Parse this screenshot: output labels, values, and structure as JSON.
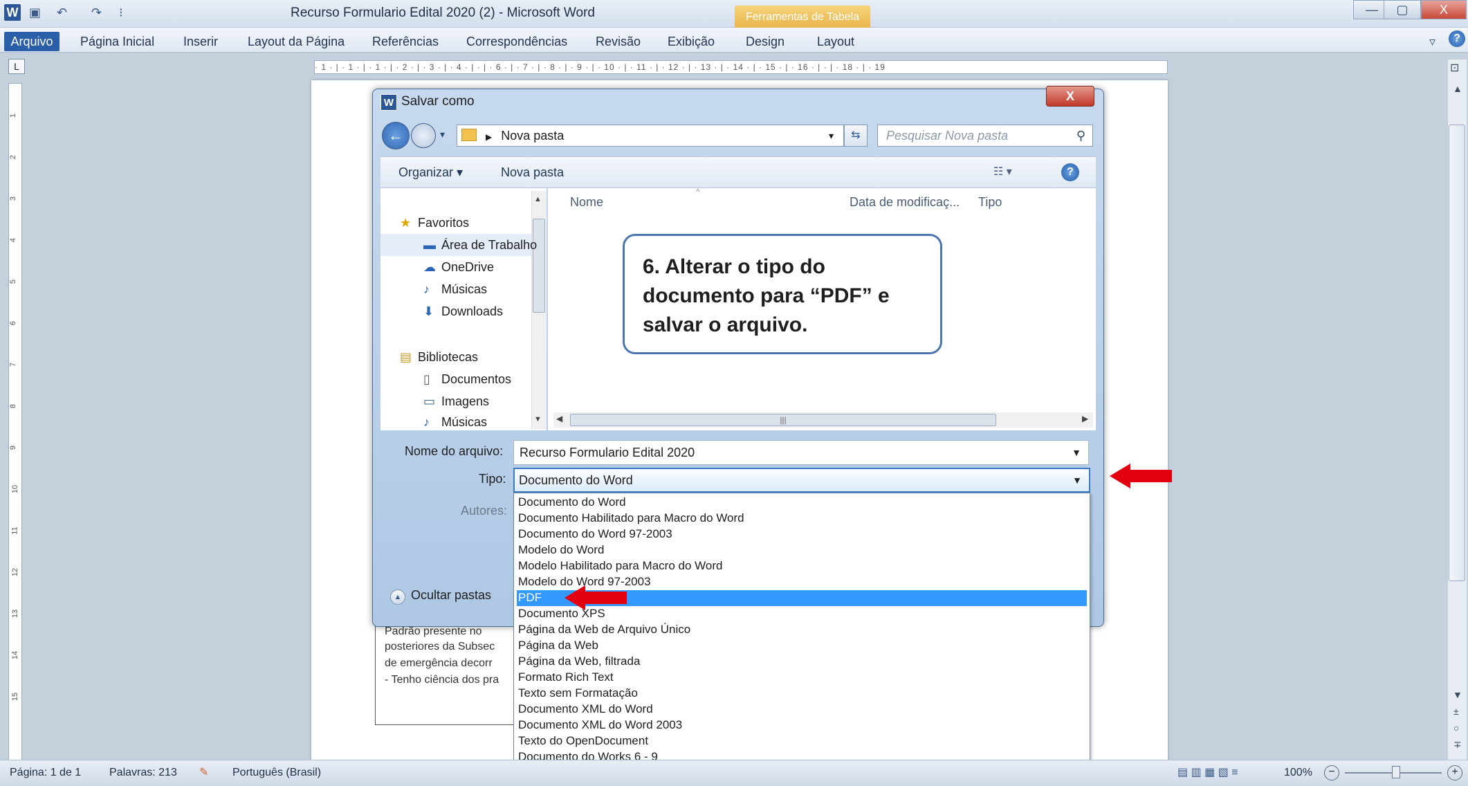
{
  "window": {
    "title": "Recurso Formulario Edital 2020 (2)  -  Microsoft Word",
    "context_tab": "Ferramentas de Tabela",
    "min": "—",
    "max": "▢",
    "close": "X"
  },
  "ribbon": {
    "tabs": [
      "Arquivo",
      "Página Inicial",
      "Inserir",
      "Layout da Página",
      "Referências",
      "Correspondências",
      "Revisão",
      "Exibição",
      "Design",
      "Layout"
    ]
  },
  "ruler": {
    "corner": "L",
    "h_text": "· 1 · | · 1 · | · 1 · | · 2 · | · 3 · | · 4 · |  · | · 6 · | · 7 · | · 8 · | · 9 · | · 10 · | · 11 · | · 12 · | · 13 · | · 14 · | · 15 · | · 16 · |  · | · 18 · | · 19",
    "v_numbers": [
      "1",
      "2",
      "3",
      "4",
      "5",
      "6",
      "7",
      "8",
      "9",
      "10",
      "11",
      "12",
      "13",
      "14",
      "15"
    ]
  },
  "document": {
    "lines": [
      "Padrão presente no",
      "posteriores da Subsec",
      "de emergência decorr",
      "- Tenho ciência dos pra"
    ]
  },
  "dialog": {
    "title": "Salvar como",
    "close": "X",
    "breadcrumb": "Nova pasta",
    "search_placeholder": "Pesquisar Nova pasta",
    "organize": "Organizar ▾",
    "new_folder": "Nova pasta",
    "help": "?",
    "nav": [
      {
        "label": "Favoritos",
        "icon": "★",
        "kind": "group"
      },
      {
        "label": "Área de Trabalho",
        "icon": "▬",
        "kind": "item"
      },
      {
        "label": "OneDrive",
        "icon": "☁",
        "kind": "item"
      },
      {
        "label": "Músicas",
        "icon": "♪",
        "kind": "item"
      },
      {
        "label": "Downloads",
        "icon": "⬇",
        "kind": "item"
      },
      {
        "label": "Bibliotecas",
        "icon": "▤",
        "kind": "group"
      },
      {
        "label": "Documentos",
        "icon": "▯",
        "kind": "item"
      },
      {
        "label": "Imagens",
        "icon": "▭",
        "kind": "item"
      },
      {
        "label": "Músicas",
        "icon": "♪",
        "kind": "item"
      }
    ],
    "columns": [
      "Nome",
      "Data de modificaç...",
      "Tipo"
    ],
    "filename_label": "Nome do arquivo:",
    "filename_value": "Recurso Formulario Edital 2020",
    "type_label": "Tipo:",
    "type_value": "Documento do Word",
    "authors_label": "Autores:",
    "hide_folders": "Ocultar pastas",
    "type_options": [
      "Documento do Word",
      "Documento Habilitado para Macro do Word",
      "Documento do Word 97-2003",
      "Modelo do Word",
      "Modelo Habilitado para Macro do Word",
      "Modelo do Word 97-2003",
      "PDF",
      "Documento XPS",
      "Página da Web de Arquivo Único",
      "Página da Web",
      "Página da Web, filtrada",
      "Formato Rich Text",
      "Texto sem Formatação",
      "Documento XML do Word",
      "Documento XML do Word 2003",
      "Texto do OpenDocument",
      "Documento do Works 6 - 9"
    ],
    "selected_option": "PDF"
  },
  "callout": {
    "text": "6. Alterar o tipo do documento para “PDF” e salvar o arquivo."
  },
  "status": {
    "page": "Página: 1 de 1",
    "words": "Palavras: 213",
    "language": "Português (Brasil)",
    "zoom": "100%"
  },
  "colors": {
    "accent": "#2a5ea8",
    "arrow": "#e3000f",
    "selection": "#3399ff"
  }
}
